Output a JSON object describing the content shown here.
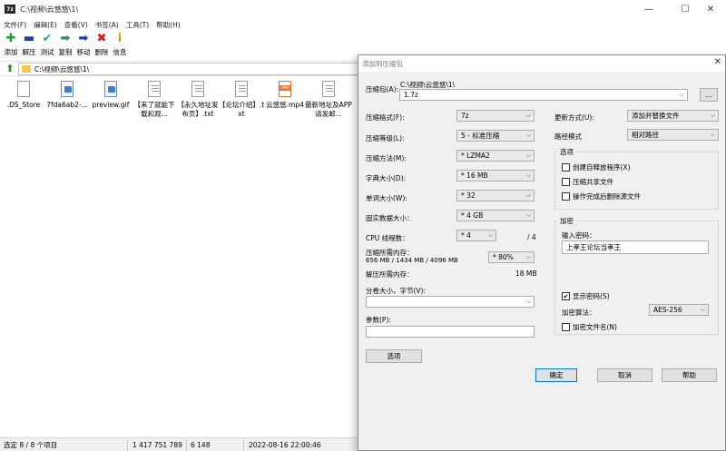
{
  "window": {
    "title": "C:\\视频\\云悠悠\\1\\",
    "app_icon": "7z",
    "controls": [
      "—",
      "☐",
      "✕"
    ]
  },
  "menu": [
    "文件(F)",
    "编辑(E)",
    "查看(V)",
    "书签(A)",
    "工具(T)",
    "帮助(H)"
  ],
  "toolbar": [
    {
      "label": "添加",
      "icon": "add-icon",
      "glyph": "✚",
      "color": "#1f9e2f"
    },
    {
      "label": "解压",
      "icon": "extract-icon",
      "glyph": "▬",
      "color": "#2b3f9f"
    },
    {
      "label": "测试",
      "icon": "test-icon",
      "glyph": "✔",
      "color": "#2ba7b8"
    },
    {
      "label": "复制",
      "icon": "copy-icon",
      "glyph": "➡",
      "color": "#2d8b5f"
    },
    {
      "label": "移动",
      "icon": "move-icon",
      "glyph": "➡",
      "color": "#1f3f9f"
    },
    {
      "label": "删除",
      "icon": "delete-icon",
      "glyph": "✖",
      "color": "#d01f1f"
    },
    {
      "label": "信息",
      "icon": "info-icon",
      "glyph": "i",
      "color": "#c9a400"
    }
  ],
  "address": {
    "path": "C:\\视频\\云悠悠\\1\\"
  },
  "files": [
    {
      "name": ".DS_Store",
      "type": "blank"
    },
    {
      "name": "7fda6ab2-...",
      "type": "img"
    },
    {
      "name": "preview.gif",
      "type": "img"
    },
    {
      "name": "【来了就能下载和观...",
      "type": "txt"
    },
    {
      "name": "【永久地址发布页】.txt",
      "type": "txt"
    },
    {
      "name": "【论坛介绍】.txt",
      "type": "txt"
    },
    {
      "name": "云悠悠.mp4",
      "type": "mp4"
    },
    {
      "name": "最新地址及APP请发邮...",
      "type": "txt"
    }
  ],
  "status": {
    "selection": "选定 8 / 8 个项目",
    "size": "1 417 751 789",
    "packed": "6 148",
    "modified": "2022-08-16 22:00:46"
  },
  "dialog": {
    "title": "添加到压缩包",
    "archive_label": "压缩包(A):",
    "archive_dir": "C:\\视频\\云悠悠\\1\\",
    "archive_name": "1.7z",
    "browse": "...",
    "format_label": "压缩格式(F):",
    "format_value": "7z",
    "level_label": "压缩等级(L):",
    "level_value": "5 - 标准压缩",
    "method_label": "压缩方法(M):",
    "method_value": "* LZMA2",
    "dict_label": "字典大小(D):",
    "dict_value": "* 16 MB",
    "word_label": "单词大小(W):",
    "word_value": "* 32",
    "solid_label": "固实数据大小：",
    "solid_value": "* 4 GB",
    "threads_label": "CPU 线程数：",
    "threads_value": "* 4",
    "threads_max": "/ 4",
    "memcomp_label": "压缩所需内存：",
    "memcomp_value": "656 MB / 1434 MB / 4096 MB",
    "memcomp_pct": "* 80%",
    "memdecomp_label": "解压所需内存：",
    "memdecomp_value": "18 MB",
    "split_label": "分卷大小，字节(V):",
    "split_value": "",
    "params_label": "参数(P):",
    "params_value": "",
    "options_btn": "选项",
    "update_label": "更新方式(U):",
    "update_value": "添加并替换文件",
    "path_label": "路径模式",
    "path_value": "相对路径",
    "options_group": "选项",
    "opt_sfx": "创建自释放程序(X)",
    "opt_shared": "压缩共享文件",
    "opt_delete": "操作完成后删除源文件",
    "encrypt_group": "加密",
    "password_label": "输入密码：",
    "password_value": "上孝王论坛当孝王",
    "show_password": "显示密码(S)",
    "enc_method_label": "加密算法：",
    "enc_method_value": "AES-256",
    "encrypt_names": "加密文件名(N)",
    "ok": "确定",
    "cancel": "取消",
    "help": "帮助"
  }
}
